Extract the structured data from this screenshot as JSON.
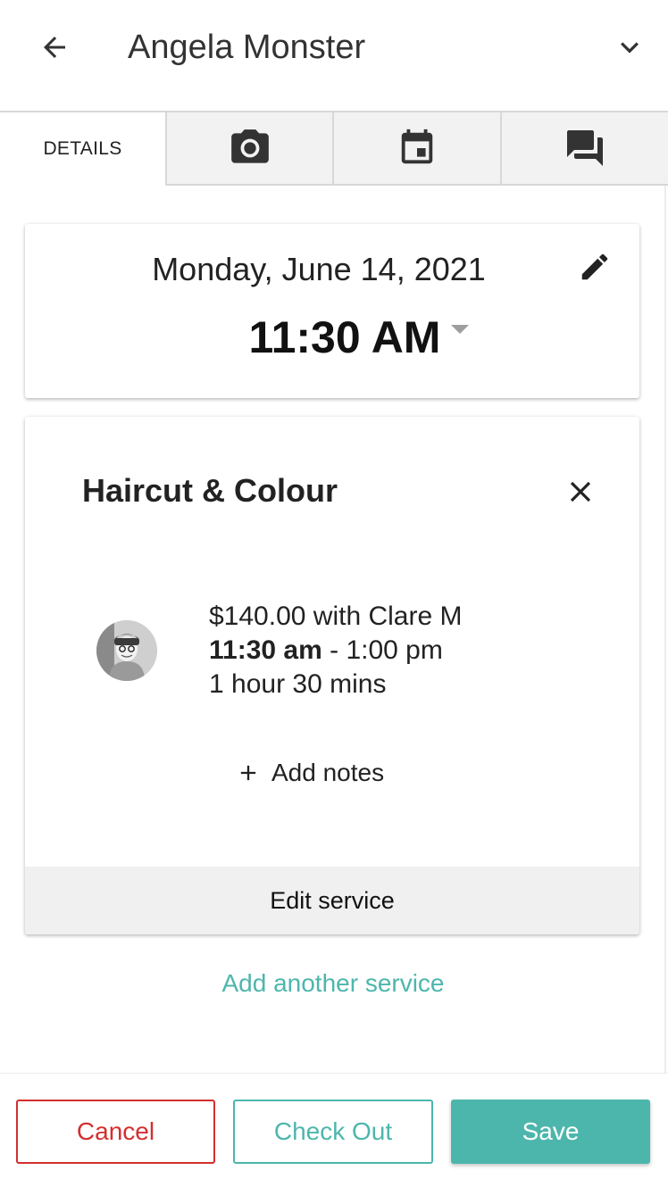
{
  "header": {
    "title": "Angela Monster",
    "back_icon": "arrow-left-icon",
    "expand_icon": "chevron-down-icon"
  },
  "tabs": [
    {
      "label": "DETAILS",
      "active": true
    },
    {
      "icon": "camera-icon",
      "active": false
    },
    {
      "icon": "calendar-icon",
      "active": false
    },
    {
      "icon": "chat-icon",
      "active": false
    }
  ],
  "appointment": {
    "date": "Monday, June 14, 2021",
    "time": "11:30 AM",
    "edit_icon": "pencil-icon"
  },
  "service": {
    "name": "Haircut & Colour",
    "price_with": "$140.00 with Clare M",
    "start": "11:30 am",
    "end_sep": " - 1:00 pm",
    "duration": "1 hour 30 mins",
    "add_notes": "Add notes",
    "edit_label": "Edit service"
  },
  "add_another": "Add another service",
  "footer": {
    "cancel": "Cancel",
    "checkout": "Check Out",
    "save": "Save"
  },
  "colors": {
    "accent": "#4db6ac",
    "danger": "#d32f2f"
  }
}
